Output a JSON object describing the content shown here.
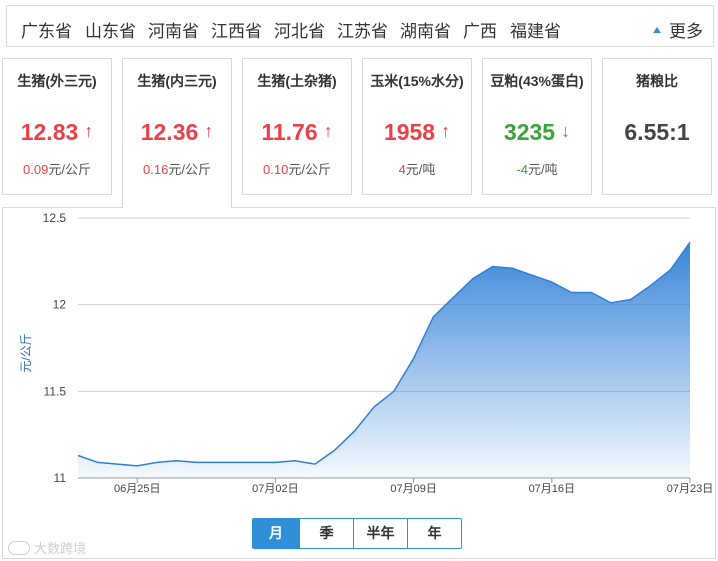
{
  "provinces": {
    "items": [
      "广东省",
      "山东省",
      "河南省",
      "江西省",
      "河北省",
      "江苏省",
      "湖南省",
      "广西",
      "福建省"
    ],
    "more_label": "更多"
  },
  "cards": [
    {
      "name": "生猪(外三元)",
      "price": "12.83",
      "arrow": "↑",
      "trend": "up",
      "change": "0.09",
      "unit": "元/公斤"
    },
    {
      "name": "生猪(内三元)",
      "price": "12.36",
      "arrow": "↑",
      "trend": "up",
      "change": "0.16",
      "unit": "元/公斤",
      "active": true
    },
    {
      "name": "生猪(土杂猪)",
      "price": "11.76",
      "arrow": "↑",
      "trend": "up",
      "change": "0.10",
      "unit": "元/公斤"
    },
    {
      "name": "玉米(15%水分)",
      "price": "1958",
      "arrow": "↑",
      "trend": "up",
      "change": "4",
      "unit": "元/吨"
    },
    {
      "name": "豆粕(43%蛋白)",
      "price": "3235",
      "arrow": "↓",
      "trend": "down",
      "change": "-4",
      "unit": "元/吨"
    },
    {
      "name": "猪粮比",
      "price": "6.55:1",
      "arrow": "",
      "trend": "neutral",
      "change": "",
      "unit": ""
    }
  ],
  "chart_data": {
    "type": "area",
    "ylabel": "元/公斤",
    "ylim": [
      11,
      12.5
    ],
    "yticks": [
      "11",
      "11.5",
      "12",
      "12.5"
    ],
    "xlim": [
      "06-22",
      "07-23"
    ],
    "xtick_labels": [
      "06月25日",
      "07月02日",
      "07月09日",
      "07月16日",
      "07月23日"
    ],
    "xtick_dates": [
      "06-25",
      "07-02",
      "07-09",
      "07-16",
      "07-23"
    ],
    "grid": true,
    "series": [
      {
        "x": [
          "06-22",
          "06-23",
          "06-24",
          "06-25",
          "06-26",
          "06-27",
          "06-28",
          "06-29",
          "06-30",
          "07-01",
          "07-02",
          "07-03",
          "07-04",
          "07-05",
          "07-06",
          "07-07",
          "07-08",
          "07-09",
          "07-10",
          "07-11",
          "07-12",
          "07-13",
          "07-14",
          "07-15",
          "07-16",
          "07-17",
          "07-18",
          "07-19",
          "07-20",
          "07-21",
          "07-22",
          "07-23"
        ],
        "values": [
          11.13,
          11.09,
          11.08,
          11.07,
          11.09,
          11.1,
          11.09,
          11.09,
          11.09,
          11.09,
          11.09,
          11.1,
          11.08,
          11.16,
          11.27,
          11.41,
          11.5,
          11.69,
          11.93,
          12.04,
          12.15,
          12.22,
          12.21,
          12.17,
          12.13,
          12.07,
          12.07,
          12.01,
          12.03,
          12.11,
          12.2,
          12.36
        ],
        "color": "#2f7fd6"
      }
    ]
  },
  "range_tabs": {
    "items": [
      "月",
      "季",
      "半年",
      "年"
    ],
    "selected": "月"
  },
  "watermark": "大数跨境"
}
